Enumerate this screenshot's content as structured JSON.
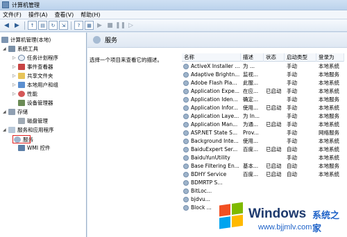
{
  "window": {
    "title": "计算机管理"
  },
  "menu": {
    "file": "文件(F)",
    "action": "操作(A)",
    "view": "查看(V)",
    "help": "帮助(H)"
  },
  "toolbar": {
    "icons": [
      "back-arrow-icon",
      "forward-arrow-icon",
      "up-folder-icon",
      "show-hide-tree-icon",
      "refresh-icon",
      "export-list-icon",
      "help-icon",
      "properties-icon",
      "start-icon",
      "stop-icon",
      "pause-icon",
      "restart-icon"
    ]
  },
  "tree": {
    "root": "计算机管理(本地)",
    "system_tools": "系统工具",
    "task_scheduler": "任务计划程序",
    "event_viewer": "事件查看器",
    "shared_folders": "共享文件夹",
    "local_users": "本地用户和组",
    "performance": "性能",
    "device_manager": "设备管理器",
    "storage": "存储",
    "disk_management": "磁盘管理",
    "services_apps": "服务和应用程序",
    "services": "服务",
    "wmi": "WMI 控件"
  },
  "right": {
    "header": "服务",
    "description": "选择一个项目来查看它的描述。",
    "columns": {
      "name": "名称",
      "desc": "描述",
      "status": "状态",
      "startup": "启动类型",
      "login": "登录为"
    }
  },
  "services": [
    {
      "name": "ActiveX Installer ...",
      "desc": "为 ...",
      "status": "",
      "startup": "手动",
      "login": "本地系统"
    },
    {
      "name": "Adaptive Brightn...",
      "desc": "监视...",
      "status": "",
      "startup": "手动",
      "login": "本地服务"
    },
    {
      "name": "Adobe Flash Pla...",
      "desc": "此服...",
      "status": "",
      "startup": "手动",
      "login": "本地系统"
    },
    {
      "name": "Application Expe...",
      "desc": "在应...",
      "status": "已启动",
      "startup": "手动",
      "login": "本地系统"
    },
    {
      "name": "Application Iden...",
      "desc": "确定...",
      "status": "",
      "startup": "手动",
      "login": "本地服务"
    },
    {
      "name": "Application Infor...",
      "desc": "使用...",
      "status": "已启动",
      "startup": "手动",
      "login": "本地系统"
    },
    {
      "name": "Application Laye...",
      "desc": "为 In...",
      "status": "",
      "startup": "手动",
      "login": "本地服务"
    },
    {
      "name": "Application Man...",
      "desc": "为通...",
      "status": "已启动",
      "startup": "手动",
      "login": "本地系统"
    },
    {
      "name": "ASP.NET State S...",
      "desc": "Prov...",
      "status": "",
      "startup": "手动",
      "login": "网络服务"
    },
    {
      "name": "Background Inte...",
      "desc": "使用...",
      "status": "",
      "startup": "手动",
      "login": "本地系统"
    },
    {
      "name": "BaiduExpert Ser...",
      "desc": "百度...",
      "status": "已启动",
      "startup": "自动",
      "login": "本地系统"
    },
    {
      "name": "BaiduYunUtility",
      "desc": "",
      "status": "",
      "startup": "手动",
      "login": "本地系统"
    },
    {
      "name": "Base Filtering En...",
      "desc": "基本...",
      "status": "已启动",
      "startup": "自动",
      "login": "本地服务"
    },
    {
      "name": "BDHY Service",
      "desc": "百度...",
      "status": "已启动",
      "startup": "自动",
      "login": "本地系统"
    },
    {
      "name": "BDMRTP S...",
      "desc": "",
      "status": "",
      "startup": "",
      "login": ""
    },
    {
      "name": "BitLoc...",
      "desc": "",
      "status": "",
      "startup": "",
      "login": ""
    },
    {
      "name": "bjdvu...",
      "desc": "",
      "status": "",
      "startup": "",
      "login": ""
    },
    {
      "name": "Block ...",
      "desc": "",
      "status": "",
      "startup": "",
      "login": ""
    }
  ],
  "watermark": {
    "brand": "Windows",
    "cn": "系统之家",
    "url": "www.bjjmlv.com"
  }
}
